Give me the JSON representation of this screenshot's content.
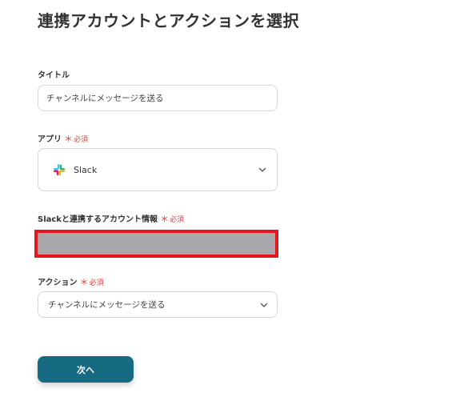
{
  "page_title": "連携アカウントとアクションを選択",
  "title_field": {
    "label": "タイトル",
    "value": "チャンネルにメッセージを送る"
  },
  "app_field": {
    "label": "アプリ",
    "required_mark": "＊",
    "required_text": "必須",
    "value": "Slack",
    "icon": "slack-logo-icon"
  },
  "account_field": {
    "label": "Slackと連携するアカウント情報",
    "required_mark": "＊",
    "required_text": "必須",
    "highlight_color": "#e5171c"
  },
  "action_field": {
    "label": "アクション",
    "required_mark": "＊",
    "required_text": "必須",
    "value": "チャンネルにメッセージを送る"
  },
  "next_button": {
    "label": "次へ",
    "color": "#166a82"
  }
}
